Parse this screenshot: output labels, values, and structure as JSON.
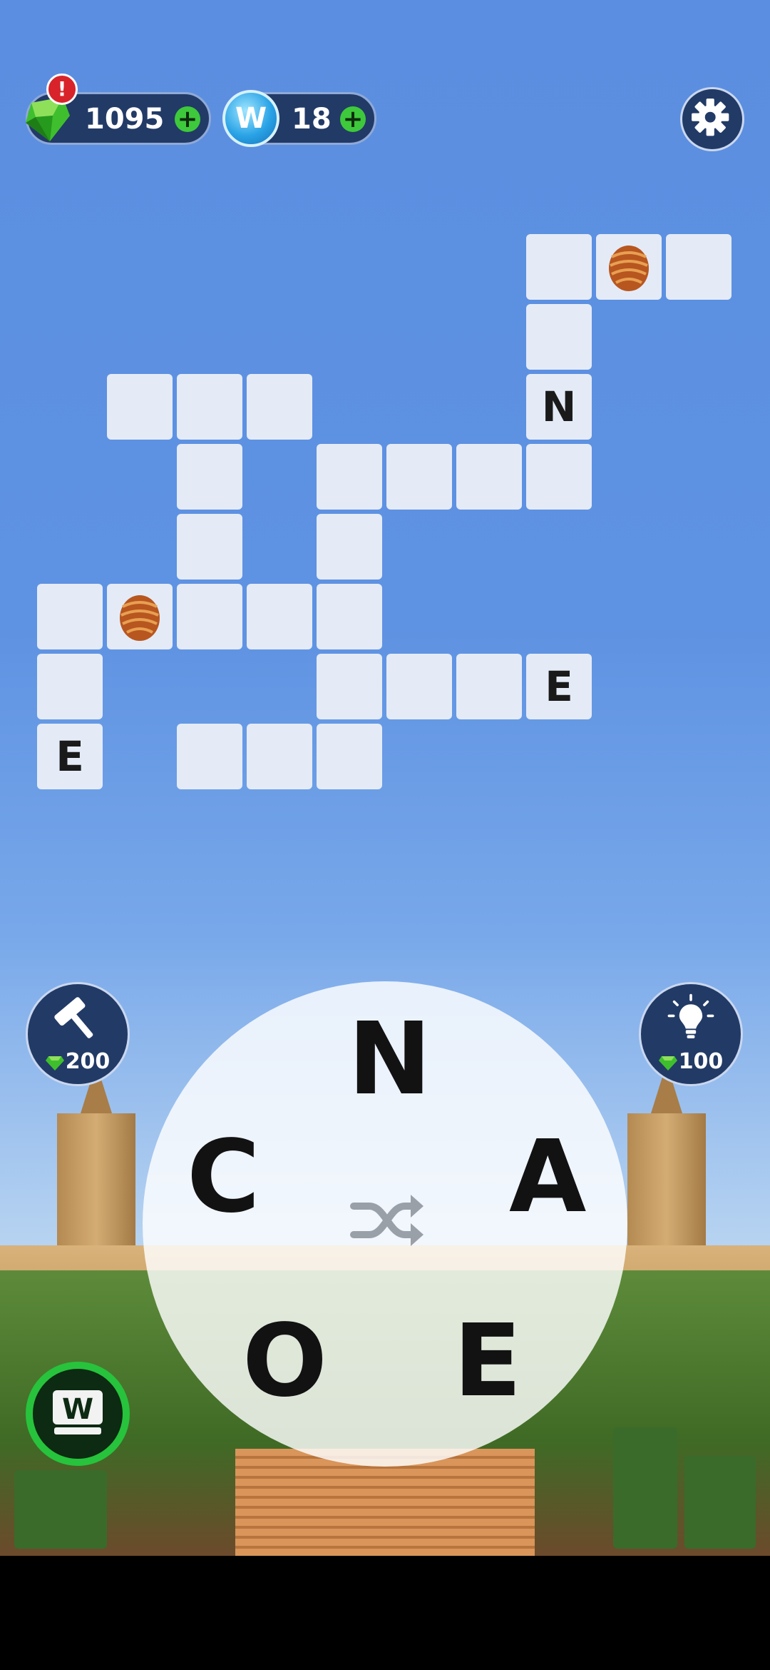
{
  "top_bar": {
    "gems_value": "1095",
    "gems_plus": "+",
    "alert_mark": "!",
    "coins_letter": "W",
    "coins_value": "18",
    "coins_plus": "+"
  },
  "board": {
    "revealed_letters": {
      "n": "N",
      "e_right": "E",
      "e_left": "E"
    }
  },
  "boosters": {
    "hammer_cost": "200",
    "hint_cost": "100"
  },
  "wheel": {
    "letters": {
      "top": "N",
      "left": "C",
      "right": "A",
      "bottom_left": "O",
      "bottom_right": "E"
    }
  },
  "colors": {
    "accent_green": "#3ec93c",
    "panel_navy": "#223a66",
    "cell_bg": "#e4ebf7"
  }
}
